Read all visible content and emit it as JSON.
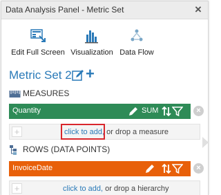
{
  "window": {
    "title": "Data Analysis Panel - Metric Set",
    "close_label": "×"
  },
  "toolbar": {
    "items": [
      {
        "label": "Edit Full Screen",
        "icon": "full-screen-icon"
      },
      {
        "label": "Visualization",
        "icon": "bar-chart-icon"
      },
      {
        "label": "Data Flow",
        "icon": "data-flow-icon"
      }
    ]
  },
  "metric_set": {
    "title": "Metric Set 2",
    "add_symbol": "+"
  },
  "measures": {
    "header": "MEASURES",
    "field": {
      "name": "Quantity",
      "aggregation": "SUM",
      "color": "#2e8b57"
    },
    "drop_zone": {
      "plus": "+",
      "link_text": "click to add,",
      "rest_text": " or drop a measure"
    }
  },
  "rows": {
    "header": "ROWS (DATA POINTS)",
    "field": {
      "name": "InvoiceDate",
      "color": "#e8600a"
    },
    "drop_zone": {
      "plus": "+",
      "link_text": "click to add,",
      "rest_text": " or drop a hierarchy"
    }
  },
  "colors": {
    "accent": "#2a7ab8",
    "highlight": "#d9262c"
  }
}
